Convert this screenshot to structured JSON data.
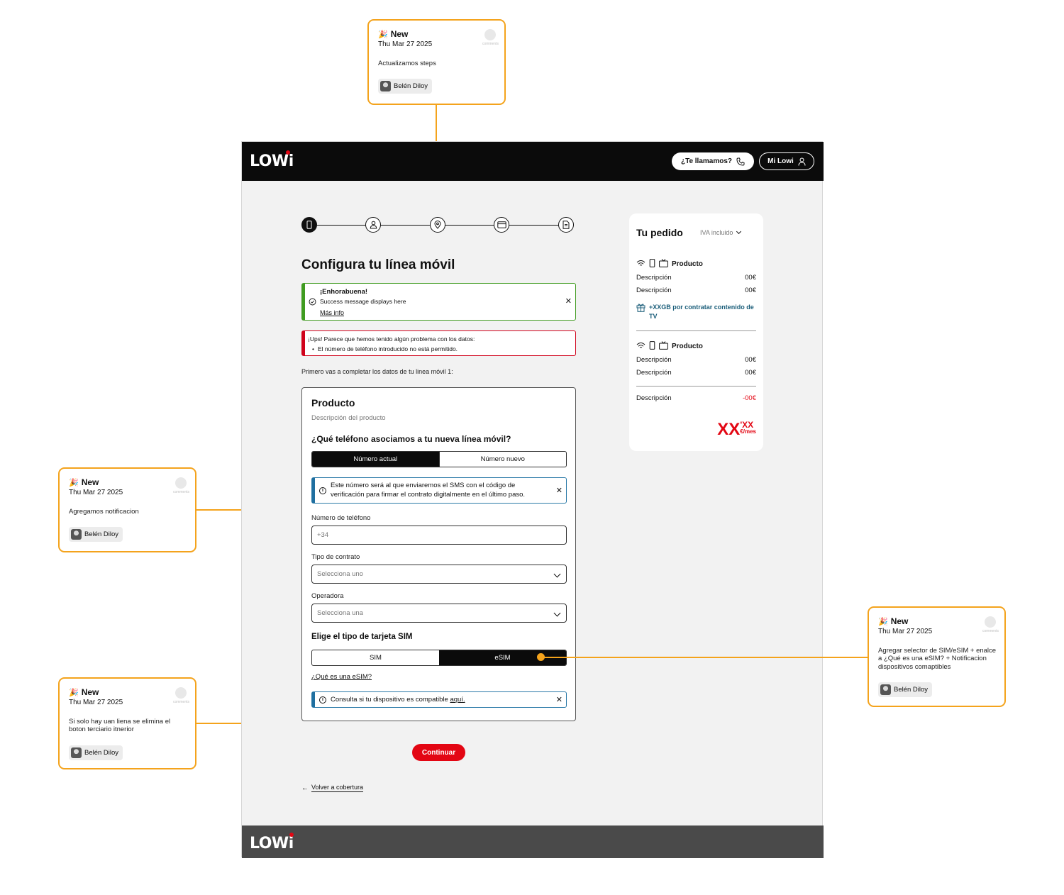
{
  "comments": [
    {
      "badge": "New",
      "date": "Thu Mar 27 2025",
      "text": "Actualizamos steps",
      "user": "Belén Diloy",
      "comments_label": "comments"
    },
    {
      "badge": "New",
      "date": "Thu Mar 27 2025",
      "text": "Agregamos notificacion",
      "user": "Belén Diloy",
      "comments_label": "comments"
    },
    {
      "badge": "New",
      "date": "Thu Mar 27 2025",
      "text": "Si solo hay uan liena se elimina el boton terciario itnerior",
      "user": "Belén Diloy",
      "comments_label": "comments"
    },
    {
      "badge": "New",
      "date": "Thu Mar 27 2025",
      "text": "Agregar selector de SIM/eSIM + enalce a ¿Qué es una eSIM? + Notificacion dispositivos comaptibles",
      "user": "Belén Diloy",
      "comments_label": "comments"
    }
  ],
  "header": {
    "logo": "LOWi",
    "call_button": "¿Te llamamos?",
    "account_button": "Mi Lowi"
  },
  "page": {
    "title": "Configura tu línea móvil",
    "intro": "Primero vas a completar los datos de tu linea móvil 1:"
  },
  "success": {
    "title": "¡Enhorabuena!",
    "message": "Success message displays here",
    "link": "Más info"
  },
  "error": {
    "title": "¡Ups! Parece que hemos tenido algún problema con los datos:",
    "item": "El número de teléfono introducido no está permitido."
  },
  "form": {
    "product_title": "Producto",
    "product_desc": "Descripción del producto",
    "question": "¿Qué teléfono asociamos a tu nueva línea móvil?",
    "toggle_current": "Número actual",
    "toggle_new": "Número nuevo",
    "sms_info": "Este número será al que enviaremos el SMS con el código de verificación para firmar el contrato digitalmente en el último paso.",
    "phone_label": "Número de teléfono",
    "phone_placeholder": "+34",
    "contract_label": "Tipo de contrato",
    "contract_value": "Selecciona uno",
    "operator_label": "Operadora",
    "operator_value": "Selecciona una",
    "sim_title": "Elige el tipo de tarjeta SIM",
    "sim_option": "SIM",
    "esim_option": "eSIM",
    "esim_link": "¿Qué es una eSIM?",
    "compat_info": "Consulta si tu dispositivo es compatible ",
    "compat_link": "aquí."
  },
  "continue_button": "Continuar",
  "back_link": "Volver a cobertura",
  "order": {
    "title": "Tu pedido",
    "tax": "IVA incluido",
    "product1": "Producto",
    "product2": "Producto",
    "desc": "Descripción",
    "price": "00€",
    "promo": "+XXGB por contratar contenido de TV",
    "discount_label": "Descripción",
    "discount_value": "-00€",
    "total_main": "XX",
    "total_cents": "'XX",
    "total_unit": "€/mes"
  },
  "colors": {
    "accent": "#e30613",
    "annotation": "#f4a31c",
    "success": "#3f9b1f",
    "info": "#1f6fa0",
    "dark": "#0b0b0b"
  }
}
